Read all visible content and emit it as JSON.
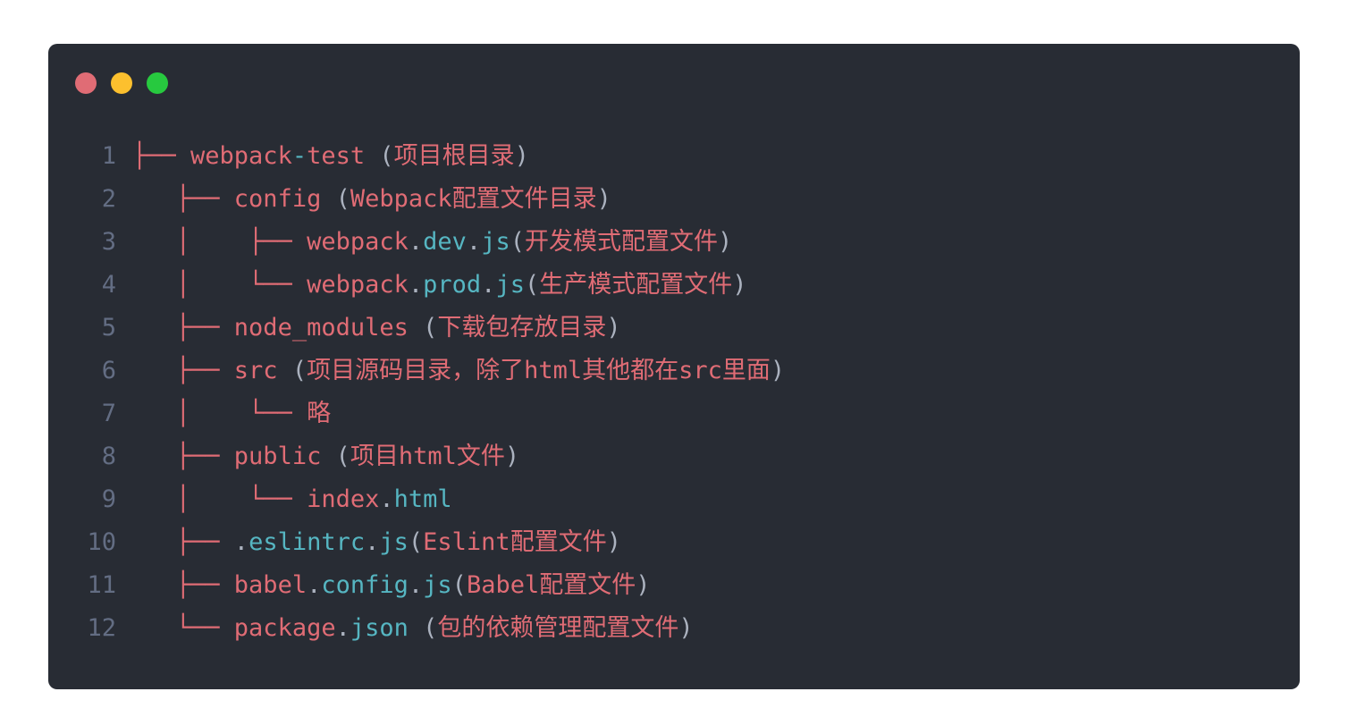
{
  "window": {
    "background": "#282c34",
    "traffic_lights": [
      {
        "name": "close",
        "color": "#e06c75"
      },
      {
        "name": "minimize",
        "color": "#fcc02e"
      },
      {
        "name": "maximize",
        "color": "#27c93f"
      }
    ]
  },
  "colors": {
    "line_number": "#636d83",
    "tree": "#e06c75",
    "name": "#e06c75",
    "ext": "#56b6c2",
    "punct": "#abb2bf",
    "comment": "#e06c75"
  },
  "lines": [
    {
      "number": "1",
      "tokens": [
        {
          "text": "├── ",
          "kind": "tree"
        },
        {
          "text": "webpack",
          "kind": "name"
        },
        {
          "text": "-",
          "kind": "ext"
        },
        {
          "text": "test",
          "kind": "name"
        },
        {
          "text": " (",
          "kind": "punct"
        },
        {
          "text": "项目根目录",
          "kind": "comment"
        },
        {
          "text": ")",
          "kind": "punct"
        }
      ]
    },
    {
      "number": "2",
      "tokens": [
        {
          "text": "   ├── ",
          "kind": "tree"
        },
        {
          "text": "config",
          "kind": "name"
        },
        {
          "text": " (",
          "kind": "punct"
        },
        {
          "text": "Webpack配置文件目录",
          "kind": "comment"
        },
        {
          "text": ")",
          "kind": "punct"
        }
      ]
    },
    {
      "number": "3",
      "tokens": [
        {
          "text": "   │    ├── ",
          "kind": "tree"
        },
        {
          "text": "webpack",
          "kind": "name"
        },
        {
          "text": ".",
          "kind": "punct"
        },
        {
          "text": "dev",
          "kind": "ext"
        },
        {
          "text": ".",
          "kind": "punct"
        },
        {
          "text": "js",
          "kind": "ext"
        },
        {
          "text": "(",
          "kind": "punct"
        },
        {
          "text": "开发模式配置文件",
          "kind": "comment"
        },
        {
          "text": ")",
          "kind": "punct"
        }
      ]
    },
    {
      "number": "4",
      "tokens": [
        {
          "text": "   │    └── ",
          "kind": "tree"
        },
        {
          "text": "webpack",
          "kind": "name"
        },
        {
          "text": ".",
          "kind": "punct"
        },
        {
          "text": "prod",
          "kind": "ext"
        },
        {
          "text": ".",
          "kind": "punct"
        },
        {
          "text": "js",
          "kind": "ext"
        },
        {
          "text": "(",
          "kind": "punct"
        },
        {
          "text": "生产模式配置文件",
          "kind": "comment"
        },
        {
          "text": ")",
          "kind": "punct"
        }
      ]
    },
    {
      "number": "5",
      "tokens": [
        {
          "text": "   ├── ",
          "kind": "tree"
        },
        {
          "text": "node_modules",
          "kind": "name"
        },
        {
          "text": " (",
          "kind": "punct"
        },
        {
          "text": "下载包存放目录",
          "kind": "comment"
        },
        {
          "text": ")",
          "kind": "punct"
        }
      ]
    },
    {
      "number": "6",
      "tokens": [
        {
          "text": "   ├── ",
          "kind": "tree"
        },
        {
          "text": "src",
          "kind": "name"
        },
        {
          "text": " (",
          "kind": "punct"
        },
        {
          "text": "项目源码目录，除了html其他都在src里面",
          "kind": "comment"
        },
        {
          "text": ")",
          "kind": "punct"
        }
      ]
    },
    {
      "number": "7",
      "tokens": [
        {
          "text": "   │    └── ",
          "kind": "tree"
        },
        {
          "text": "略",
          "kind": "comment"
        }
      ]
    },
    {
      "number": "8",
      "tokens": [
        {
          "text": "   ├── ",
          "kind": "tree"
        },
        {
          "text": "public",
          "kind": "name"
        },
        {
          "text": " (",
          "kind": "punct"
        },
        {
          "text": "项目html文件",
          "kind": "comment"
        },
        {
          "text": ")",
          "kind": "punct"
        }
      ]
    },
    {
      "number": "9",
      "tokens": [
        {
          "text": "   │    └── ",
          "kind": "tree"
        },
        {
          "text": "index",
          "kind": "name"
        },
        {
          "text": ".",
          "kind": "punct"
        },
        {
          "text": "html",
          "kind": "ext"
        }
      ]
    },
    {
      "number": "10",
      "tokens": [
        {
          "text": "   ├── ",
          "kind": "tree"
        },
        {
          "text": ".",
          "kind": "punct"
        },
        {
          "text": "eslintrc",
          "kind": "ext"
        },
        {
          "text": ".",
          "kind": "punct"
        },
        {
          "text": "js",
          "kind": "ext"
        },
        {
          "text": "(",
          "kind": "punct"
        },
        {
          "text": "Eslint配置文件",
          "kind": "comment"
        },
        {
          "text": ")",
          "kind": "punct"
        }
      ]
    },
    {
      "number": "11",
      "tokens": [
        {
          "text": "   ├── ",
          "kind": "tree"
        },
        {
          "text": "babel",
          "kind": "name"
        },
        {
          "text": ".",
          "kind": "punct"
        },
        {
          "text": "config",
          "kind": "ext"
        },
        {
          "text": ".",
          "kind": "punct"
        },
        {
          "text": "js",
          "kind": "ext"
        },
        {
          "text": "(",
          "kind": "punct"
        },
        {
          "text": "Babel配置文件",
          "kind": "comment"
        },
        {
          "text": ")",
          "kind": "punct"
        }
      ]
    },
    {
      "number": "12",
      "tokens": [
        {
          "text": "   └── ",
          "kind": "tree"
        },
        {
          "text": "package",
          "kind": "name"
        },
        {
          "text": ".",
          "kind": "punct"
        },
        {
          "text": "json",
          "kind": "ext"
        },
        {
          "text": " (",
          "kind": "punct"
        },
        {
          "text": "包的依赖管理配置文件",
          "kind": "comment"
        },
        {
          "text": ")",
          "kind": "punct"
        }
      ]
    }
  ]
}
